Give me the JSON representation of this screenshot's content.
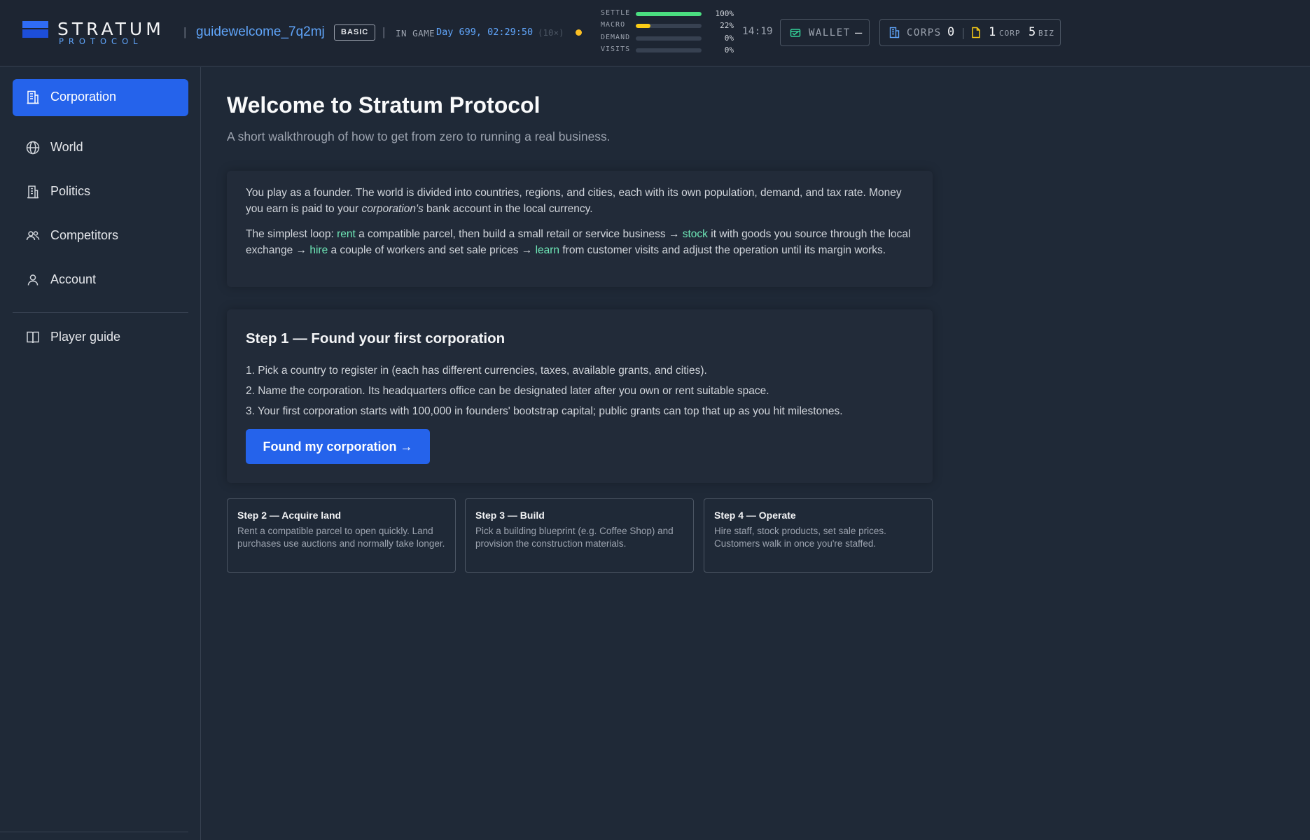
{
  "header": {
    "logo_word": "STRATUM",
    "logo_sub": "PROTOCOL",
    "username": "guidewelcome_7q2mj",
    "badge": "BASIC",
    "ingame_label": "IN GAME",
    "ingame_time": "Day 699, 02:29:50",
    "ingame_speed": "(10×)",
    "meters": [
      {
        "label": "SETTLE",
        "value": "100%",
        "fraction": 1.0,
        "color": "#4ade80"
      },
      {
        "label": "MACRO",
        "value": "22%",
        "fraction": 0.22,
        "color": "#facc15"
      },
      {
        "label": "DEMAND",
        "value": "0%",
        "fraction": 0.0,
        "color": "#4ade80"
      },
      {
        "label": "VISITS",
        "value": "0%",
        "fraction": 0.0,
        "color": "#4ade80"
      }
    ],
    "clock": "14:19",
    "wallet": {
      "label": "WALLET",
      "value": "–"
    },
    "corps": {
      "label": "CORPS",
      "count": "0",
      "corp_count": "1",
      "corp_label": "CORP",
      "biz_count": "5",
      "biz_label": "BIZ"
    }
  },
  "sidebar": {
    "items": [
      {
        "label": "Corporation",
        "icon": "building-icon",
        "active": true
      },
      {
        "label": "World",
        "icon": "globe-icon"
      },
      {
        "label": "Politics",
        "icon": "government-building-icon"
      },
      {
        "label": "Competitors",
        "icon": "users-icon"
      },
      {
        "label": "Account",
        "icon": "user-icon"
      },
      {
        "label": "Player guide",
        "icon": "book-icon"
      }
    ]
  },
  "main": {
    "title": "Welcome to Stratum Protocol",
    "subtitle": "A short walkthrough of how to get from zero to running a real business.",
    "intro": {
      "p1_a": "You play as a founder. The world is divided into countries, regions, and cities, each with its own population, demand, and tax rate. Money you earn is paid to your ",
      "p1_em": "corporation's",
      "p1_b": " bank account in the local currency.",
      "p2_a": "The simplest loop: ",
      "p2_rent": "rent",
      "p2_b": " a compatible parcel, then build a small retail or service business → ",
      "p2_stock": "stock",
      "p2_c": " it with goods you source through the local exchange → ",
      "p2_hire": "hire",
      "p2_d": " a couple of workers and set sale prices → ",
      "p2_learn": "learn",
      "p2_e": " from customer visits and adjust the operation until its margin works."
    },
    "step1": {
      "title": "Step 1 — Found your first corporation",
      "items": [
        "1. Pick a country to register in (each has different currencies, taxes, available grants, and cities).",
        "2. Name the corporation. Its headquarters office can be designated later after you own or rent suitable space.",
        "3. Your first corporation starts with 100,000 in founders' bootstrap capital; public grants can top that up as you hit milestones."
      ],
      "button": "Found my corporation →"
    },
    "steps": [
      {
        "title": "Step 2 — Acquire land",
        "desc": "Rent a compatible parcel to open quickly. Land purchases use auctions and normally take longer."
      },
      {
        "title": "Step 3 — Build",
        "desc": "Pick a building blueprint (e.g. Coffee Shop) and provision the construction materials."
      },
      {
        "title": "Step 4 — Operate",
        "desc": "Hire staff, stock products, set sale prices. Customers walk in once you're staffed."
      }
    ]
  },
  "colors": {
    "accent": "#2563eb",
    "link": "#60a5fa",
    "highlight": "#6ee7b7",
    "status_dot": "#fbbf24"
  }
}
